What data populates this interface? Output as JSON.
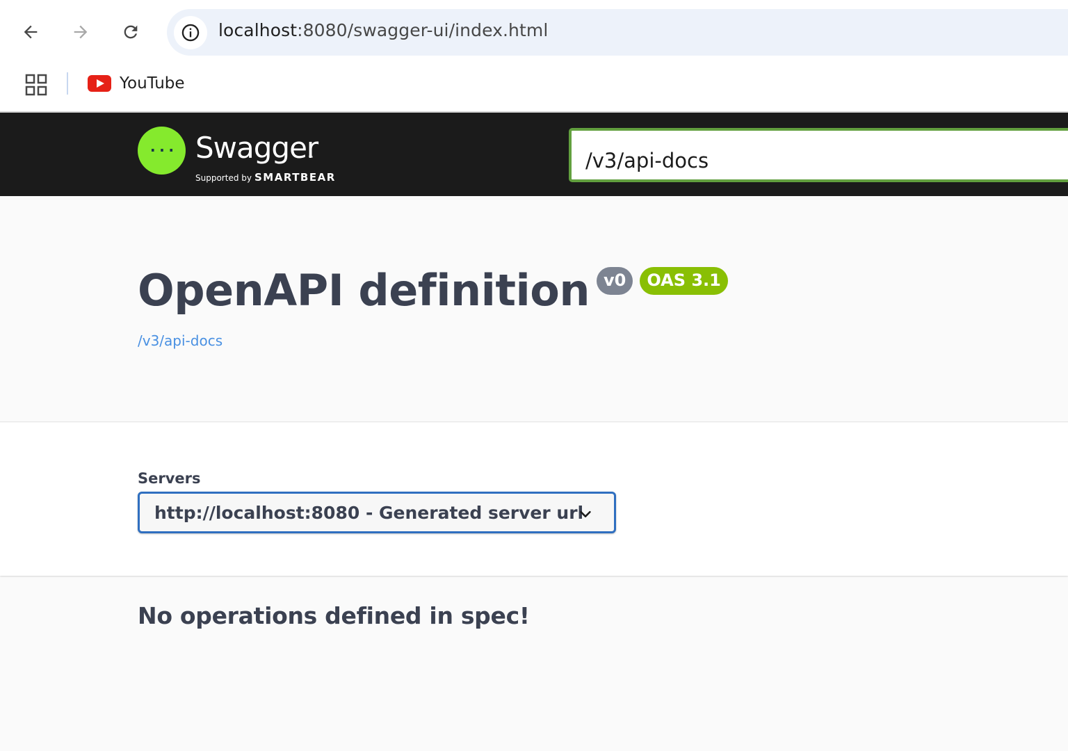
{
  "browser": {
    "url_host": "localhost",
    "url_rest": ":8080/swagger-ui/index.html",
    "icons": {
      "back": "arrow-left-icon",
      "forward": "arrow-right-icon",
      "reload": "reload-icon",
      "site_info": "info-icon"
    },
    "bookmarks": [
      {
        "label": "YouTube",
        "icon": "youtube-icon"
      }
    ]
  },
  "topbar": {
    "logo_name": "Swagger",
    "logo_tm": "™",
    "logo_supported": "Supported by",
    "logo_smartbear": "SMARTBEAR",
    "spec_url": "/v3/api-docs",
    "accent_color": "#85ea2d"
  },
  "info": {
    "title": "OpenAPI definition",
    "version_badge": "v0",
    "oas_badge": "OAS 3.1",
    "spec_link": "/v3/api-docs"
  },
  "servers": {
    "label": "Servers",
    "selected": "http://localhost:8080 - Generated server url"
  },
  "operations": {
    "empty_message": "No operations defined in spec!"
  }
}
